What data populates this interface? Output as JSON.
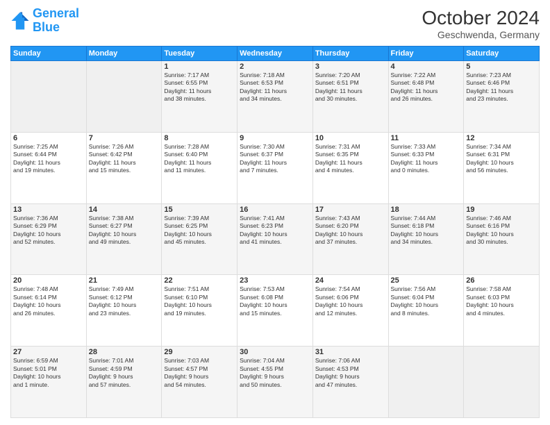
{
  "header": {
    "logo_line1": "General",
    "logo_line2": "Blue",
    "month_title": "October 2024",
    "location": "Geschwenda, Germany"
  },
  "weekdays": [
    "Sunday",
    "Monday",
    "Tuesday",
    "Wednesday",
    "Thursday",
    "Friday",
    "Saturday"
  ],
  "weeks": [
    [
      {
        "day": "",
        "info": ""
      },
      {
        "day": "",
        "info": ""
      },
      {
        "day": "1",
        "info": "Sunrise: 7:17 AM\nSunset: 6:55 PM\nDaylight: 11 hours\nand 38 minutes."
      },
      {
        "day": "2",
        "info": "Sunrise: 7:18 AM\nSunset: 6:53 PM\nDaylight: 11 hours\nand 34 minutes."
      },
      {
        "day": "3",
        "info": "Sunrise: 7:20 AM\nSunset: 6:51 PM\nDaylight: 11 hours\nand 30 minutes."
      },
      {
        "day": "4",
        "info": "Sunrise: 7:22 AM\nSunset: 6:48 PM\nDaylight: 11 hours\nand 26 minutes."
      },
      {
        "day": "5",
        "info": "Sunrise: 7:23 AM\nSunset: 6:46 PM\nDaylight: 11 hours\nand 23 minutes."
      }
    ],
    [
      {
        "day": "6",
        "info": "Sunrise: 7:25 AM\nSunset: 6:44 PM\nDaylight: 11 hours\nand 19 minutes."
      },
      {
        "day": "7",
        "info": "Sunrise: 7:26 AM\nSunset: 6:42 PM\nDaylight: 11 hours\nand 15 minutes."
      },
      {
        "day": "8",
        "info": "Sunrise: 7:28 AM\nSunset: 6:40 PM\nDaylight: 11 hours\nand 11 minutes."
      },
      {
        "day": "9",
        "info": "Sunrise: 7:30 AM\nSunset: 6:37 PM\nDaylight: 11 hours\nand 7 minutes."
      },
      {
        "day": "10",
        "info": "Sunrise: 7:31 AM\nSunset: 6:35 PM\nDaylight: 11 hours\nand 4 minutes."
      },
      {
        "day": "11",
        "info": "Sunrise: 7:33 AM\nSunset: 6:33 PM\nDaylight: 11 hours\nand 0 minutes."
      },
      {
        "day": "12",
        "info": "Sunrise: 7:34 AM\nSunset: 6:31 PM\nDaylight: 10 hours\nand 56 minutes."
      }
    ],
    [
      {
        "day": "13",
        "info": "Sunrise: 7:36 AM\nSunset: 6:29 PM\nDaylight: 10 hours\nand 52 minutes."
      },
      {
        "day": "14",
        "info": "Sunrise: 7:38 AM\nSunset: 6:27 PM\nDaylight: 10 hours\nand 49 minutes."
      },
      {
        "day": "15",
        "info": "Sunrise: 7:39 AM\nSunset: 6:25 PM\nDaylight: 10 hours\nand 45 minutes."
      },
      {
        "day": "16",
        "info": "Sunrise: 7:41 AM\nSunset: 6:23 PM\nDaylight: 10 hours\nand 41 minutes."
      },
      {
        "day": "17",
        "info": "Sunrise: 7:43 AM\nSunset: 6:20 PM\nDaylight: 10 hours\nand 37 minutes."
      },
      {
        "day": "18",
        "info": "Sunrise: 7:44 AM\nSunset: 6:18 PM\nDaylight: 10 hours\nand 34 minutes."
      },
      {
        "day": "19",
        "info": "Sunrise: 7:46 AM\nSunset: 6:16 PM\nDaylight: 10 hours\nand 30 minutes."
      }
    ],
    [
      {
        "day": "20",
        "info": "Sunrise: 7:48 AM\nSunset: 6:14 PM\nDaylight: 10 hours\nand 26 minutes."
      },
      {
        "day": "21",
        "info": "Sunrise: 7:49 AM\nSunset: 6:12 PM\nDaylight: 10 hours\nand 23 minutes."
      },
      {
        "day": "22",
        "info": "Sunrise: 7:51 AM\nSunset: 6:10 PM\nDaylight: 10 hours\nand 19 minutes."
      },
      {
        "day": "23",
        "info": "Sunrise: 7:53 AM\nSunset: 6:08 PM\nDaylight: 10 hours\nand 15 minutes."
      },
      {
        "day": "24",
        "info": "Sunrise: 7:54 AM\nSunset: 6:06 PM\nDaylight: 10 hours\nand 12 minutes."
      },
      {
        "day": "25",
        "info": "Sunrise: 7:56 AM\nSunset: 6:04 PM\nDaylight: 10 hours\nand 8 minutes."
      },
      {
        "day": "26",
        "info": "Sunrise: 7:58 AM\nSunset: 6:03 PM\nDaylight: 10 hours\nand 4 minutes."
      }
    ],
    [
      {
        "day": "27",
        "info": "Sunrise: 6:59 AM\nSunset: 5:01 PM\nDaylight: 10 hours\nand 1 minute."
      },
      {
        "day": "28",
        "info": "Sunrise: 7:01 AM\nSunset: 4:59 PM\nDaylight: 9 hours\nand 57 minutes."
      },
      {
        "day": "29",
        "info": "Sunrise: 7:03 AM\nSunset: 4:57 PM\nDaylight: 9 hours\nand 54 minutes."
      },
      {
        "day": "30",
        "info": "Sunrise: 7:04 AM\nSunset: 4:55 PM\nDaylight: 9 hours\nand 50 minutes."
      },
      {
        "day": "31",
        "info": "Sunrise: 7:06 AM\nSunset: 4:53 PM\nDaylight: 9 hours\nand 47 minutes."
      },
      {
        "day": "",
        "info": ""
      },
      {
        "day": "",
        "info": ""
      }
    ]
  ]
}
